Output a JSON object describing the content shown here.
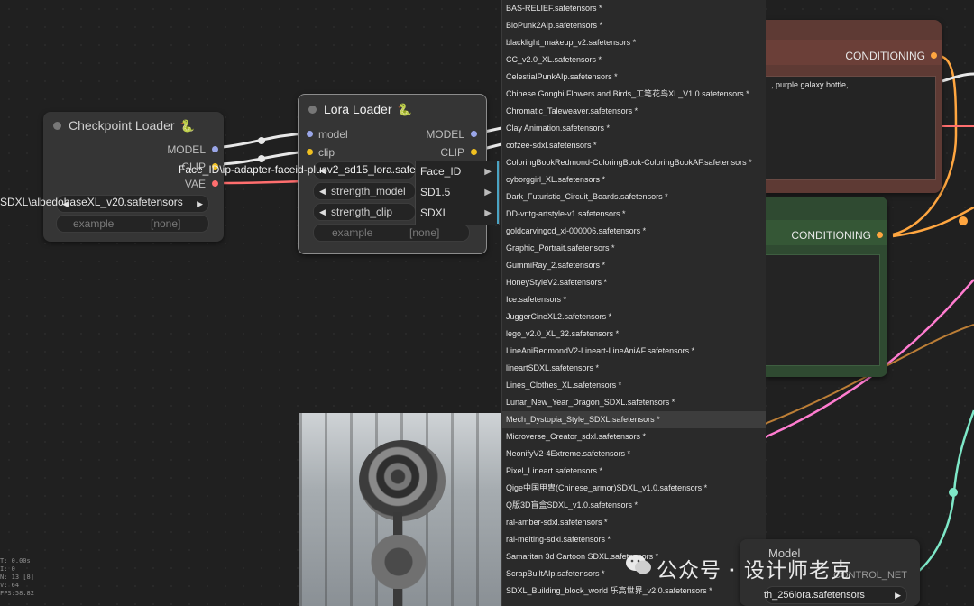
{
  "checkpoint": {
    "title": "Checkpoint Loader",
    "outputs": [
      "MODEL",
      "CLIP",
      "VAE"
    ],
    "ckpt": "SDXL\\albedobaseXL_v20.safetensors",
    "example_label": "example",
    "example_value": "[none]"
  },
  "lora": {
    "title": "Lora Loader",
    "inputs": [
      "model",
      "clip"
    ],
    "outputs": [
      "MODEL",
      "CLIP"
    ],
    "lora_name": "Face_ID\\ip-adapter-faceid-plusv2_sd15_lora.safetensors",
    "strength_model": "strength_model",
    "strength_clip": "strength_clip",
    "example_label": "example",
    "example_value": "[none]"
  },
  "context_menu": [
    "Face_ID",
    "SD1.5",
    "SDXL"
  ],
  "conditioning": {
    "top_label": "CONDITIONING",
    "top_text": ", purple galaxy bottle,",
    "mid_label": "CONDITIONING"
  },
  "dropdown": [
    "BAS-RELIEF.safetensors *",
    "BioPunk2AIp.safetensors *",
    "blacklight_makeup_v2.safetensors *",
    "CC_v2.0_XL.safetensors *",
    "CelestialPunkAIp.safetensors *",
    "Chinese Gongbi Flowers and Birds_工笔花鸟XL_V1.0.safetensors *",
    "Chromatic_Taleweaver.safetensors *",
    "Clay Animation.safetensors *",
    "cofzee-sdxl.safetensors *",
    "ColoringBookRedmond-ColoringBook-ColoringBookAF.safetensors *",
    "cyborggirl_XL.safetensors *",
    "Dark_Futuristic_Circuit_Boards.safetensors *",
    "DD-vntg-artstyle-v1.safetensors *",
    "goldcarvingcd_xl-000006.safetensors *",
    "Graphic_Portrait.safetensors *",
    "GummiRay_2.safetensors *",
    "HoneyStyleV2.safetensors *",
    "Ice.safetensors *",
    "JuggerCineXL2.safetensors *",
    "lego_v2.0_XL_32.safetensors *",
    "LineAniRedmondV2-Lineart-LineAniAF.safetensors *",
    "lineartSDXL.safetensors *",
    "Lines_Clothes_XL.safetensors *",
    "Lunar_New_Year_Dragon_SDXL.safetensors *",
    "Mech_Dystopia_Style_SDXL.safetensors *",
    "Microverse_Creator_sdxl.safetensors *",
    "NeonifyV2-4Extreme.safetensors *",
    "Pixel_Lineart.safetensors *",
    "Qige中国甲胄(Chinese_armor)SDXL_v1.0.safetensors *",
    "Q版3D盲盒SDXL_v1.0.safetensors *",
    "ral-amber-sdxl.safetensors *",
    "ral-melting-sdxl.safetensors *",
    "Samaritan 3d Cartoon SDXL.safetensors *",
    "ScrapBuiltAIp.safetensors *",
    "SDXL_Building_block_world 乐高世界_v2.0.safetensors *"
  ],
  "highlight_index": 24,
  "bottom_node": {
    "title": "Model",
    "overlay": "CONTROL_NET",
    "lora_value": "th_256lora.safetensors"
  },
  "stats": [
    "T: 0.00s",
    "I: 0",
    "N: 13 [8]",
    "V: 64",
    "FPS:58.82"
  ],
  "watermark": "公众号 · 设计师老克",
  "colors": {
    "model_wire": "#e8e8e8",
    "clip_wire": "#f0c020",
    "vae_wire": "#ff6e6e",
    "cond_wire": "#ffa640",
    "pink_wire": "#ff7cd0",
    "green_wire": "#7ee8c8"
  }
}
